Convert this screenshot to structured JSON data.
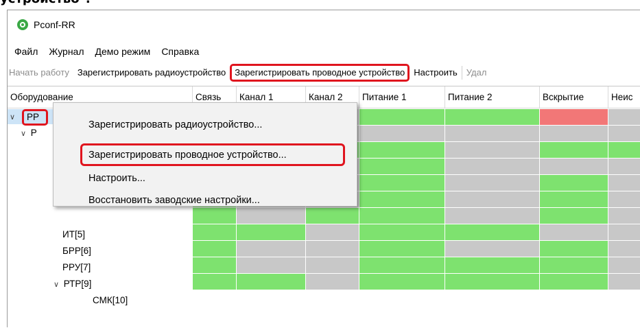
{
  "page_heading_fragment": "устройство\".",
  "window": {
    "title": "Pconf-RR",
    "app_icon": "shield-icon",
    "accent": "#3aa845"
  },
  "menu": [
    "Файл",
    "Журнал",
    "Демо режим",
    "Справка"
  ],
  "toolbar": {
    "start": "Начать работу",
    "register_radio": "Зарегистрировать радиоустройство",
    "register_wired": "Зарегистрировать проводное устройство",
    "configure": "Настроить",
    "cut_off": "Удал"
  },
  "columns": [
    "Оборудование",
    "Связь",
    "Канал 1",
    "Канал 2",
    "Питание 1",
    "Питание 2",
    "Вскрытие",
    "Неис"
  ],
  "tree": [
    {
      "label": "PP",
      "level": 0,
      "expanded": true,
      "selected": true
    },
    {
      "label": "P",
      "level": 1,
      "expanded": true
    },
    {
      "label": "ИТ[5]",
      "level": 2
    },
    {
      "label": "БРР[6]",
      "level": 2
    },
    {
      "label": "РРУ[7]",
      "level": 2
    },
    {
      "label": "РТР[9]",
      "level": 2,
      "expanded": true
    },
    {
      "label": "СМК[10]",
      "level": 3
    }
  ],
  "status_colors": {
    "ok": "#7ee26f",
    "alarm": "#f27777",
    "none": "#c8c8c8",
    "highlight": "#e0141e"
  },
  "status_rows": [
    [
      "gray",
      "gray",
      "gray",
      "green",
      "green",
      "red",
      "gray"
    ],
    [
      "gray",
      "gray",
      "gray",
      "gray",
      "gray",
      "gray",
      "gray"
    ],
    [
      "green",
      "gray",
      "green",
      "green",
      "gray",
      "green",
      "green"
    ],
    [
      "gray",
      "gray",
      "gray",
      "green",
      "gray",
      "gray",
      "gray"
    ],
    [
      "green",
      "gray",
      "gray",
      "green",
      "gray",
      "green",
      "gray"
    ],
    [
      "green",
      "gray",
      "gray",
      "green",
      "gray",
      "green",
      "gray"
    ],
    [
      "green",
      "gray",
      "green",
      "green",
      "gray",
      "green",
      "gray"
    ],
    [
      "green",
      "green",
      "gray",
      "green",
      "green",
      "gray",
      "gray"
    ],
    [
      "green",
      "gray",
      "gray",
      "green",
      "gray",
      "green",
      "gray"
    ],
    [
      "green",
      "gray",
      "gray",
      "green",
      "green",
      "green",
      "gray"
    ],
    [
      "green",
      "green",
      "gray",
      "green",
      "green",
      "green",
      "gray"
    ]
  ],
  "context_menu": [
    "Зарегистрировать радиоустройство...",
    "Зарегистрировать проводное устройство...",
    "Настроить...",
    "Восстановить заводские настройки..."
  ]
}
